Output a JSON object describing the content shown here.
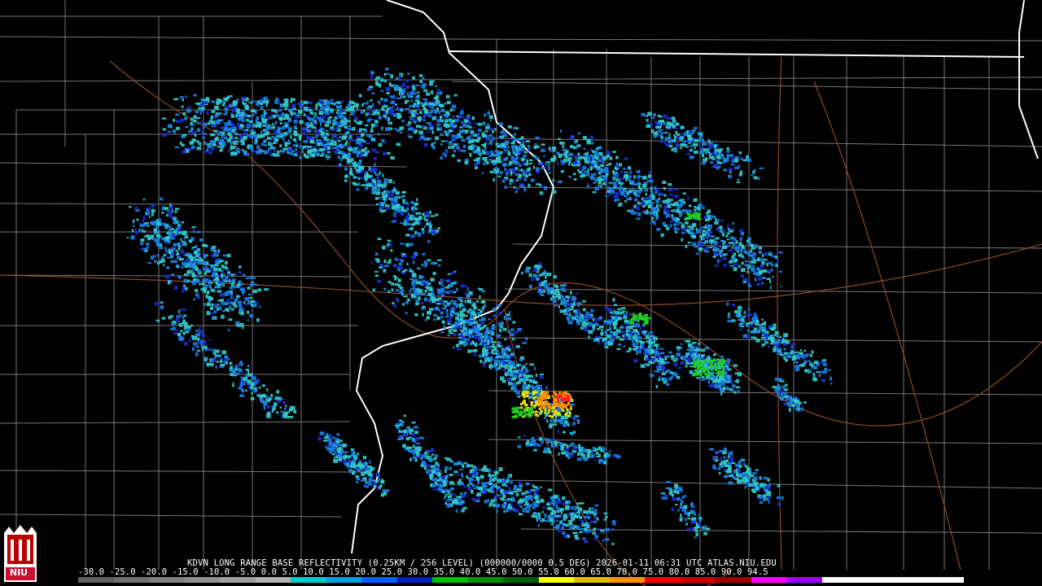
{
  "caption": "KDVN LONG RANGE BASE REFLECTIVITY (0.25KM / 256 LEVEL) (000000/0000 0.5 DEG) 2026-01-11 06:31 UTC  ATLAS.NIU.EDU",
  "scale_labels": "-30.0 -25.0 -20.0 -15.0 -10.0 -5.0  0.0  5.0  10.0  15.0  20.0  25.0  30.0  35.0  40.0  45.0  50.0  55.0  60.0  65.0  70.0  75.0  80.0  85.0  90.0  94.5",
  "logo_text": "NIU",
  "colors": {
    "background": "#000000",
    "state_border": "#ffffff",
    "county_line": "#7a7a7a",
    "road": "#8a4a2a",
    "light_cyan": "#33cccc",
    "medium_blue": "#1a7fe6",
    "dark_blue": "#1a2fd6",
    "green": "#22cc22",
    "yellow": "#e6e600",
    "orange": "#ff8c00",
    "red": "#ff2020"
  },
  "colorbar": [
    "#606060",
    "#707070",
    "#808080",
    "#909090",
    "#a0a0a0",
    "#b0b0b0",
    "#00cccc",
    "#00a0e0",
    "#0060ff",
    "#0020c0",
    "#00c000",
    "#009000",
    "#006000",
    "#ffff00",
    "#e0c000",
    "#ff9000",
    "#ff0000",
    "#d00000",
    "#a00000",
    "#ff00ff",
    "#a000ff",
    "#ffffff",
    "#ffffff",
    "#ffffff",
    "#ffffff"
  ]
}
